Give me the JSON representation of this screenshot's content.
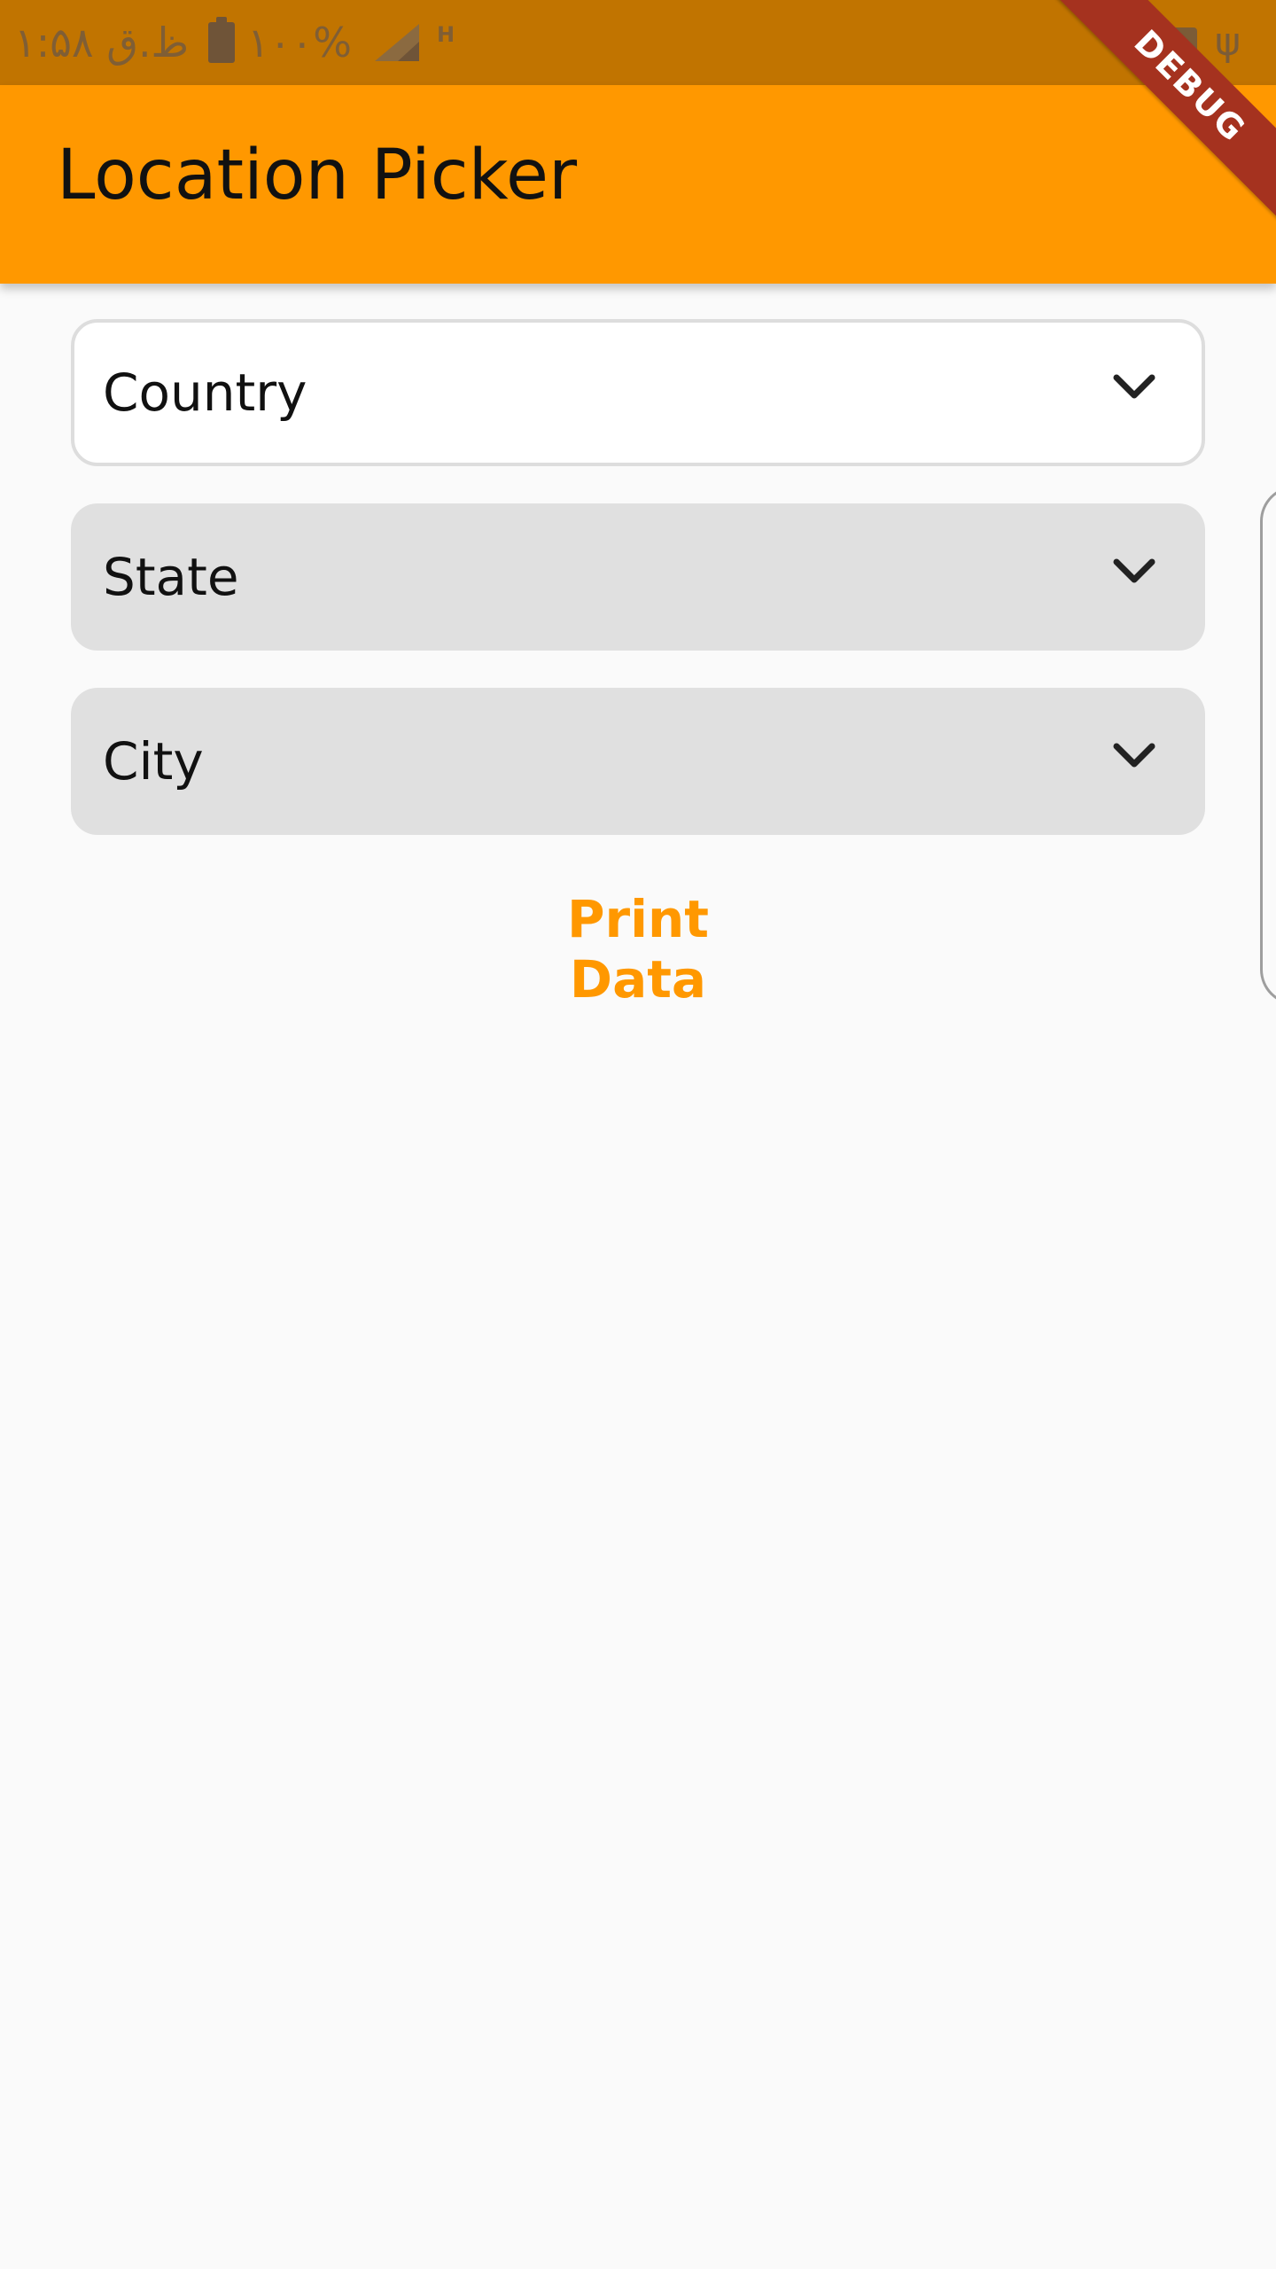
{
  "status_bar": {
    "time_text": "ظ.ق ۱:۵۸",
    "battery_text": "۱۰۰%",
    "network_type": "H",
    "icons": {
      "battery": "battery-full-icon",
      "signal": "signal-icon",
      "mail": "mail-icon",
      "usb": "usb-icon"
    }
  },
  "app_bar": {
    "title": "Location Picker",
    "color": "#ff9800"
  },
  "debug_banner": {
    "label": "DEBUG",
    "color": "#a5321f"
  },
  "form": {
    "country": {
      "placeholder": "Country"
    },
    "state": {
      "placeholder": "State"
    },
    "city": {
      "placeholder": "City"
    }
  },
  "actions": {
    "print_label": "Print Data",
    "accent_color": "#ff9800"
  }
}
